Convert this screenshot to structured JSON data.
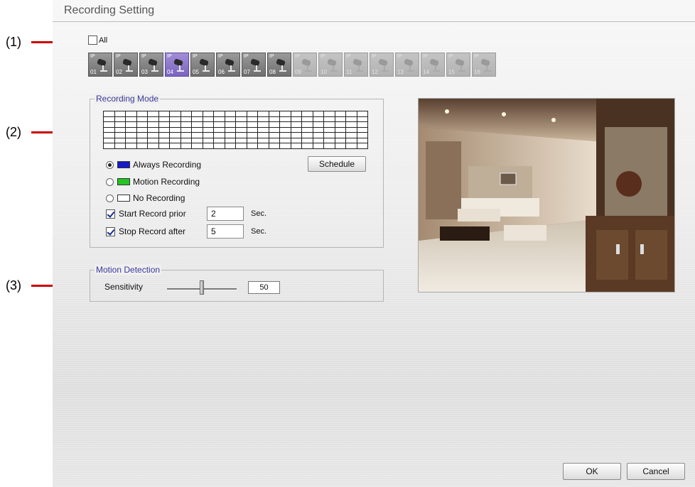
{
  "callouts": [
    "(1)",
    "(2)",
    "(3)"
  ],
  "window": {
    "title": "Recording Setting"
  },
  "camera_select": {
    "all_label": "All",
    "all_checked": false,
    "cameras": [
      {
        "ip": "IP",
        "number": "01",
        "state": "enabled"
      },
      {
        "ip": "IP",
        "number": "02",
        "state": "enabled"
      },
      {
        "ip": "IP",
        "number": "03",
        "state": "enabled"
      },
      {
        "ip": "IP",
        "number": "04",
        "state": "selected"
      },
      {
        "ip": "IP",
        "number": "05",
        "state": "enabled"
      },
      {
        "ip": "IP",
        "number": "06",
        "state": "enabled"
      },
      {
        "ip": "IP",
        "number": "07",
        "state": "enabled"
      },
      {
        "ip": "IP",
        "number": "08",
        "state": "enabled"
      },
      {
        "ip": "IP",
        "number": "09",
        "state": "disabled"
      },
      {
        "ip": "IP",
        "number": "10",
        "state": "disabled"
      },
      {
        "ip": "IP",
        "number": "11",
        "state": "disabled"
      },
      {
        "ip": "IP",
        "number": "12",
        "state": "disabled"
      },
      {
        "ip": "IP",
        "number": "13",
        "state": "disabled"
      },
      {
        "ip": "IP",
        "number": "14",
        "state": "disabled"
      },
      {
        "ip": "IP",
        "number": "15",
        "state": "disabled"
      },
      {
        "ip": "IP",
        "number": "16",
        "state": "disabled"
      }
    ]
  },
  "recording_mode": {
    "legend": "Recording Mode",
    "grid": {
      "columns": 24,
      "rows": 7
    },
    "options": {
      "always": {
        "label": "Always Recording",
        "color": "#1a1ac8",
        "selected": true
      },
      "motion": {
        "label": "Motion Recording",
        "color": "#22c422",
        "selected": false
      },
      "none": {
        "label": "No Recording",
        "color": "#ffffff",
        "selected": false
      }
    },
    "schedule_button": "Schedule",
    "start_prior": {
      "label": "Start Record prior",
      "checked": true,
      "value": "2",
      "unit": "Sec."
    },
    "stop_after": {
      "label": "Stop Record after",
      "checked": true,
      "value": "5",
      "unit": "Sec."
    }
  },
  "motion_detection": {
    "legend": "Motion Detection",
    "sensitivity_label": "Sensitivity",
    "sensitivity_value": "50"
  },
  "buttons": {
    "ok": "OK",
    "cancel": "Cancel"
  },
  "colors": {
    "legend_text": "#3a3a9a",
    "callout_line": "#cc0000",
    "selected_camera": "#8a76cc"
  }
}
